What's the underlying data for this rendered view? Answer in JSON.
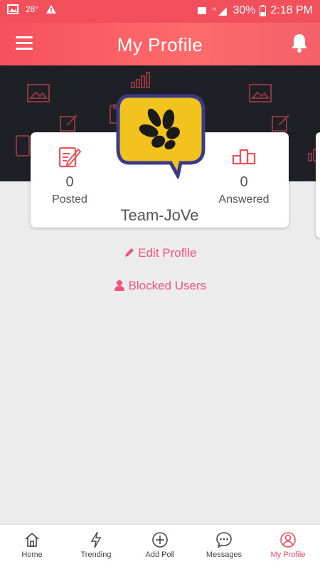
{
  "status": {
    "temp": "28°",
    "battery": "30%",
    "time": "2:18 PM"
  },
  "header": {
    "title": "My Profile"
  },
  "profile": {
    "username": "Team-JoVe",
    "posted": {
      "count": "0",
      "label": "Posted"
    },
    "answered": {
      "count": "0",
      "label": "Answered"
    }
  },
  "actions": {
    "edit": "Edit Profile",
    "blocked": "Blocked Users"
  },
  "tabs": [
    {
      "label": "Home",
      "icon": "home-icon"
    },
    {
      "label": "Trending",
      "icon": "bolt-icon"
    },
    {
      "label": "Add Poll",
      "icon": "plus-circle-icon"
    },
    {
      "label": "Messages",
      "icon": "chat-icon"
    },
    {
      "label": "My Profile",
      "icon": "user-circle-icon"
    }
  ],
  "colors": {
    "accent": "#f24f5c",
    "link": "#f0557e",
    "banner": "#1f1f26",
    "avatar": "#f2c21f"
  }
}
